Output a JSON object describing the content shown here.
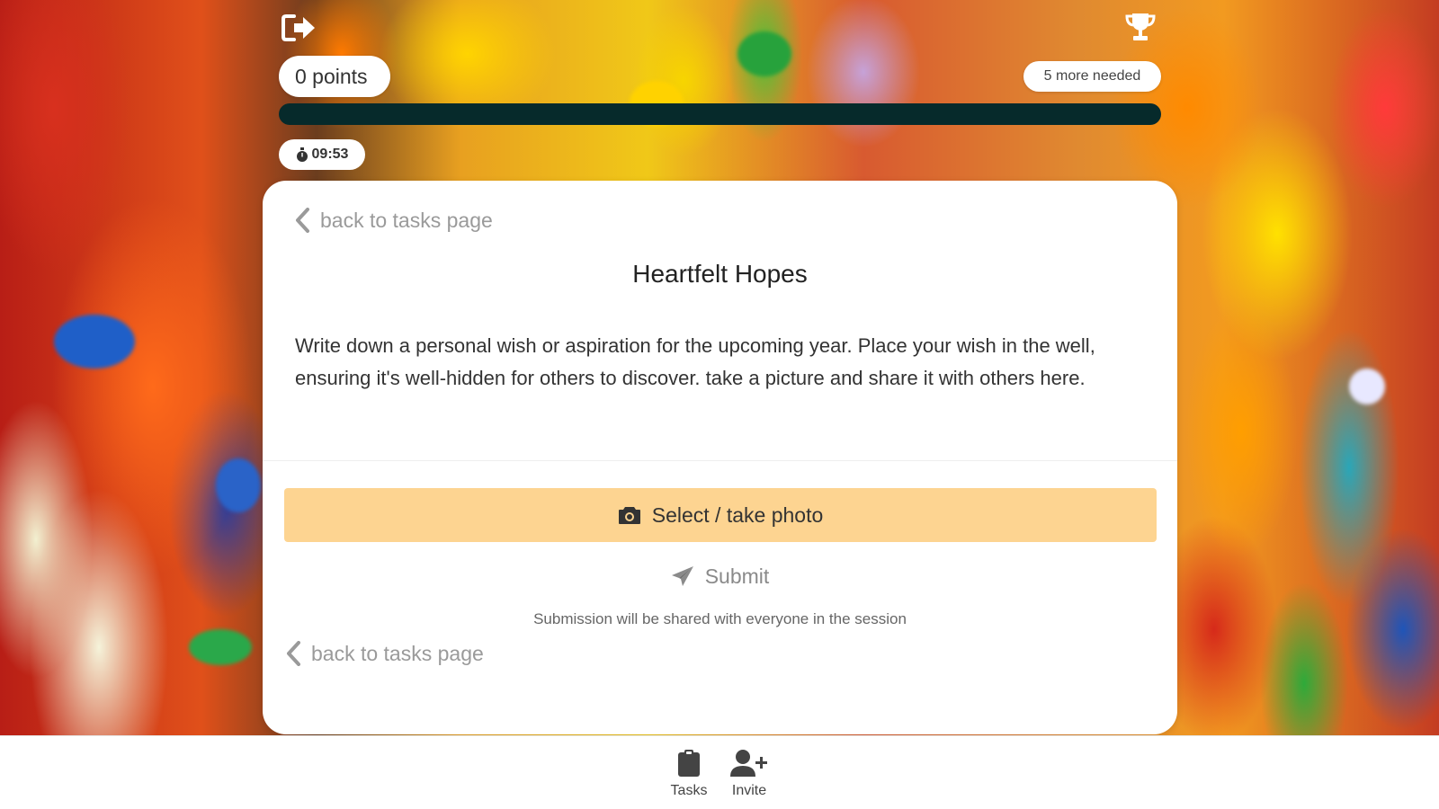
{
  "header": {
    "points_label": "0 points",
    "needed_label": "5 more needed",
    "progress_fraction": 0,
    "timer": "09:53",
    "logout_icon": "sign-out-icon",
    "trophy_icon": "trophy-icon"
  },
  "task": {
    "back_label": "back to tasks page",
    "title": "Heartfelt Hopes",
    "description": "Write down a personal wish or aspiration for the upcoming year. Place your wish in the well, ensuring it's well-hidden for others to discover. take a picture and share it with others here.",
    "photo_button": "Select / take photo",
    "submit_button": "Submit",
    "share_note": "Submission will be shared with everyone in the session"
  },
  "nav": {
    "tasks_label": "Tasks",
    "invite_label": "Invite"
  },
  "colors": {
    "photo_button_bg": "#fdd491",
    "progress_track": "#062a2b"
  }
}
